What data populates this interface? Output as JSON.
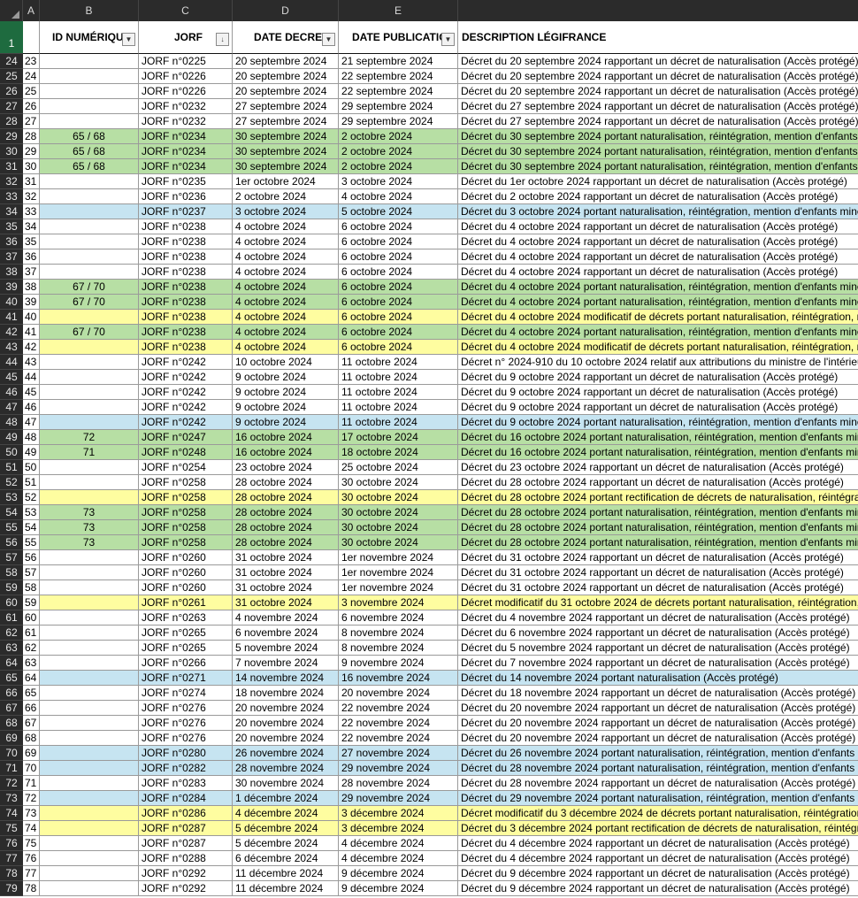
{
  "columns": {
    "a": "A",
    "b": "B",
    "c": "C",
    "d": "D",
    "e": "E"
  },
  "header_row_number": "1",
  "headers": {
    "b": "ID NUMÉRIQUE",
    "c": "JORF",
    "d": "DATE DECRET",
    "e": "DATE PUBLICATION",
    "f": "DESCRIPTION LÉGIFRANCE"
  },
  "icons": {
    "filter": "filter-dropdown-icon",
    "sorted_filter": "sort-ascending-filter-icon",
    "select_all": "select-all-triangle-icon"
  },
  "colors": {
    "green": "#b7dfa4",
    "yellow": "#fefda0",
    "blue": "#c6e4f1",
    "selected_row_header": "#1e6b3f"
  },
  "rows": [
    {
      "r": "24",
      "a": "23",
      "b": "",
      "c": "JORF n°0225",
      "d": "20 septembre 2024",
      "e": "21 septembre 2024",
      "f": "Décret du 20 septembre 2024 rapportant un décret de naturalisation (Accès protégé)",
      "bg": ""
    },
    {
      "r": "25",
      "a": "24",
      "b": "",
      "c": "JORF n°0226",
      "d": "20 septembre 2024",
      "e": "22 septembre 2024",
      "f": "Décret du 20 septembre 2024 rapportant un décret de naturalisation (Accès protégé)",
      "bg": ""
    },
    {
      "r": "26",
      "a": "25",
      "b": "",
      "c": "JORF n°0226",
      "d": "20 septembre 2024",
      "e": "22 septembre 2024",
      "f": "Décret du 20 septembre 2024 rapportant un décret de naturalisation (Accès protégé)",
      "bg": ""
    },
    {
      "r": "27",
      "a": "26",
      "b": "",
      "c": "JORF n°0232",
      "d": "27 septembre 2024",
      "e": "29 septembre 2024",
      "f": "Décret du 27 septembre 2024 rapportant un décret de naturalisation (Accès protégé)",
      "bg": ""
    },
    {
      "r": "28",
      "a": "27",
      "b": "",
      "c": "JORF n°0232",
      "d": "27 septembre 2024",
      "e": "29 septembre 2024",
      "f": "Décret du 27 septembre 2024 rapportant un décret de naturalisation (Accès protégé)",
      "bg": ""
    },
    {
      "r": "29",
      "a": "28",
      "b": "65 / 68",
      "c": "JORF n°0234",
      "d": "30 septembre 2024",
      "e": "2 octobre 2024",
      "f": "Décret du 30 septembre 2024 portant naturalisation, réintégration, mention d'enfants m",
      "bg": "green"
    },
    {
      "r": "30",
      "a": "29",
      "b": "65 / 68",
      "c": "JORF n°0234",
      "d": "30 septembre 2024",
      "e": "2 octobre 2024",
      "f": "Décret du 30 septembre 2024 portant naturalisation, réintégration, mention d'enfants m",
      "bg": "green"
    },
    {
      "r": "31",
      "a": "30",
      "b": "65 / 68",
      "c": "JORF n°0234",
      "d": "30 septembre 2024",
      "e": "2 octobre 2024",
      "f": "Décret du 30 septembre 2024 portant naturalisation, réintégration, mention d'enfants m",
      "bg": "green"
    },
    {
      "r": "32",
      "a": "31",
      "b": "",
      "c": "JORF n°0235",
      "d": "1er octobre 2024",
      "e": "3 octobre 2024",
      "f": "Décret du 1er octobre 2024 rapportant un décret de naturalisation (Accès protégé)",
      "bg": ""
    },
    {
      "r": "33",
      "a": "32",
      "b": "",
      "c": "JORF n°0236",
      "d": "2 octobre 2024",
      "e": "4 octobre 2024",
      "f": "Décret du 2 octobre 2024 rapportant un décret de naturalisation (Accès protégé)",
      "bg": ""
    },
    {
      "r": "34",
      "a": "33",
      "b": "",
      "c": "JORF n°0237",
      "d": "3 octobre 2024",
      "e": "5 octobre 2024",
      "f": "Décret du 3 octobre 2024 portant naturalisation, réintégration, mention d'enfants mine",
      "bg": "blue"
    },
    {
      "r": "35",
      "a": "34",
      "b": "",
      "c": "JORF n°0238",
      "d": "4 octobre 2024",
      "e": "6 octobre 2024",
      "f": "Décret du 4 octobre 2024 rapportant un décret de naturalisation (Accès protégé)",
      "bg": ""
    },
    {
      "r": "36",
      "a": "35",
      "b": "",
      "c": "JORF n°0238",
      "d": "4 octobre 2024",
      "e": "6 octobre 2024",
      "f": "Décret du 4 octobre 2024 rapportant un décret de naturalisation (Accès protégé)",
      "bg": ""
    },
    {
      "r": "37",
      "a": "36",
      "b": "",
      "c": "JORF n°0238",
      "d": "4 octobre 2024",
      "e": "6 octobre 2024",
      "f": "Décret du 4 octobre 2024 rapportant un décret de naturalisation (Accès protégé)",
      "bg": ""
    },
    {
      "r": "38",
      "a": "37",
      "b": "",
      "c": "JORF n°0238",
      "d": "4 octobre 2024",
      "e": "6 octobre 2024",
      "f": "Décret du 4 octobre 2024 rapportant un décret de naturalisation (Accès protégé)",
      "bg": ""
    },
    {
      "r": "39",
      "a": "38",
      "b": "67 / 70",
      "c": "JORF n°0238",
      "d": "4 octobre 2024",
      "e": "6 octobre 2024",
      "f": "Décret du 4 octobre 2024 portant naturalisation, réintégration, mention d'enfants mine",
      "bg": "green"
    },
    {
      "r": "40",
      "a": "39",
      "b": "67 / 70",
      "c": "JORF n°0238",
      "d": "4 octobre 2024",
      "e": "6 octobre 2024",
      "f": "Décret du 4 octobre 2024 portant naturalisation, réintégration, mention d'enfants mine",
      "bg": "green"
    },
    {
      "r": "41",
      "a": "40",
      "b": "",
      "c": "JORF n°0238",
      "d": "4 octobre 2024",
      "e": "6 octobre 2024",
      "f": "Décret du 4 octobre 2024 modificatif de décrets portant naturalisation, réintégration, m",
      "bg": "yellow"
    },
    {
      "r": "42",
      "a": "41",
      "b": "67 / 70",
      "c": "JORF n°0238",
      "d": "4 octobre 2024",
      "e": "6 octobre 2024",
      "f": "Décret du 4 octobre 2024 portant naturalisation, réintégration, mention d'enfants mine",
      "bg": "green"
    },
    {
      "r": "43",
      "a": "42",
      "b": "",
      "c": "JORF n°0238",
      "d": "4 octobre 2024",
      "e": "6 octobre 2024",
      "f": "Décret du 4 octobre 2024 modificatif de décrets portant naturalisation, réintégration, m",
      "bg": "yellow"
    },
    {
      "r": "44",
      "a": "43",
      "b": "",
      "c": "JORF n°0242",
      "d": "10 octobre 2024",
      "e": "11 octobre 2024",
      "f": "Décret n° 2024-910 du 10 octobre 2024 relatif aux attributions du ministre de l'intérieu",
      "bg": ""
    },
    {
      "r": "45",
      "a": "44",
      "b": "",
      "c": "JORF n°0242",
      "d": "9 octobre 2024",
      "e": "11 octobre 2024",
      "f": "Décret du 9 octobre 2024 rapportant un décret de naturalisation (Accès protégé)",
      "bg": ""
    },
    {
      "r": "46",
      "a": "45",
      "b": "",
      "c": "JORF n°0242",
      "d": "9 octobre 2024",
      "e": "11 octobre 2024",
      "f": "Décret du 9 octobre 2024 rapportant un décret de naturalisation (Accès protégé)",
      "bg": ""
    },
    {
      "r": "47",
      "a": "46",
      "b": "",
      "c": "JORF n°0242",
      "d": "9 octobre 2024",
      "e": "11 octobre 2024",
      "f": "Décret du 9 octobre 2024 rapportant un décret de naturalisation (Accès protégé)",
      "bg": ""
    },
    {
      "r": "48",
      "a": "47",
      "b": "",
      "c": "JORF n°0242",
      "d": "9 octobre 2024",
      "e": "11 octobre 2024",
      "f": "Décret du 9 octobre 2024 portant naturalisation, réintégration, mention d'enfants mine",
      "bg": "blue"
    },
    {
      "r": "49",
      "a": "48",
      "b": "72",
      "c": "JORF n°0247",
      "d": "16 octobre 2024",
      "e": "17 octobre 2024",
      "f": "Décret du 16 octobre 2024 portant naturalisation, réintégration, mention d'enfants min",
      "bg": "green"
    },
    {
      "r": "50",
      "a": "49",
      "b": "71",
      "c": "JORF n°0248",
      "d": "16 octobre 2024",
      "e": "18 octobre 2024",
      "f": "Décret du 16 octobre 2024 portant naturalisation, réintégration, mention d'enfants min",
      "bg": "green"
    },
    {
      "r": "51",
      "a": "50",
      "b": "",
      "c": "JORF n°0254",
      "d": "23 octobre 2024",
      "e": "25 octobre 2024",
      "f": "Décret du 23 octobre 2024 rapportant un décret de naturalisation (Accès protégé)",
      "bg": ""
    },
    {
      "r": "52",
      "a": "51",
      "b": "",
      "c": "JORF n°0258",
      "d": "28 octobre 2024",
      "e": "30 octobre 2024",
      "f": "Décret du 28 octobre 2024 rapportant un décret de naturalisation (Accès protégé)",
      "bg": ""
    },
    {
      "r": "53",
      "a": "52",
      "b": "",
      "c": "JORF n°0258",
      "d": "28 octobre 2024",
      "e": "30 octobre 2024",
      "f": "Décret du 28 octobre 2024 portant rectification de décrets de naturalisation, réintégrat",
      "bg": "yellow"
    },
    {
      "r": "54",
      "a": "53",
      "b": "73",
      "c": "JORF n°0258",
      "d": "28 octobre 2024",
      "e": "30 octobre 2024",
      "f": "Décret du 28 octobre 2024 portant naturalisation, réintégration, mention d'enfants min",
      "bg": "green"
    },
    {
      "r": "55",
      "a": "54",
      "b": "73",
      "c": "JORF n°0258",
      "d": "28 octobre 2024",
      "e": "30 octobre 2024",
      "f": "Décret du 28 octobre 2024 portant naturalisation, réintégration, mention d'enfants min",
      "bg": "green"
    },
    {
      "r": "56",
      "a": "55",
      "b": "73",
      "c": "JORF n°0258",
      "d": "28 octobre 2024",
      "e": "30 octobre 2024",
      "f": "Décret du 28 octobre 2024 portant naturalisation, réintégration, mention d'enfants min",
      "bg": "green"
    },
    {
      "r": "57",
      "a": "56",
      "b": "",
      "c": "JORF n°0260",
      "d": "31 octobre 2024",
      "e": "1er novembre 2024",
      "f": "Décret du 31 octobre 2024 rapportant un décret de naturalisation (Accès protégé)",
      "bg": ""
    },
    {
      "r": "58",
      "a": "57",
      "b": "",
      "c": "JORF n°0260",
      "d": "31 octobre 2024",
      "e": "1er novembre 2024",
      "f": "Décret du 31 octobre 2024 rapportant un décret de naturalisation (Accès protégé)",
      "bg": ""
    },
    {
      "r": "59",
      "a": "58",
      "b": "",
      "c": "JORF n°0260",
      "d": "31 octobre 2024",
      "e": "1er novembre 2024",
      "f": "Décret du 31 octobre 2024 rapportant un décret de naturalisation (Accès protégé)",
      "bg": ""
    },
    {
      "r": "60",
      "a": "59",
      "b": "",
      "c": "JORF n°0261",
      "d": "31 octobre 2024",
      "e": "3 novembre 2024",
      "f": "Décret modificatif du 31 octobre 2024 de décrets portant naturalisation, réintégration, r",
      "bg": "yellow"
    },
    {
      "r": "61",
      "a": "60",
      "b": "",
      "c": "JORF n°0263",
      "d": "4 novembre 2024",
      "e": "6 novembre 2024",
      "f": "Décret du 4 novembre 2024 rapportant un décret de naturalisation (Accès protégé)",
      "bg": ""
    },
    {
      "r": "62",
      "a": "61",
      "b": "",
      "c": "JORF n°0265",
      "d": "6 novembre 2024",
      "e": "8 novembre 2024",
      "f": "Décret du 6 novembre 2024 rapportant un décret de naturalisation (Accès protégé)",
      "bg": ""
    },
    {
      "r": "63",
      "a": "62",
      "b": "",
      "c": "JORF n°0265",
      "d": "5 novembre 2024",
      "e": "8 novembre 2024",
      "f": "Décret du 5 novembre 2024 rapportant un décret de naturalisation (Accès protégé)",
      "bg": ""
    },
    {
      "r": "64",
      "a": "63",
      "b": "",
      "c": "JORF n°0266",
      "d": "7 novembre 2024",
      "e": "9 novembre 2024",
      "f": "Décret du 7 novembre 2024 rapportant un décret de naturalisation (Accès protégé)",
      "bg": ""
    },
    {
      "r": "65",
      "a": "64",
      "b": "",
      "c": "JORF n°0271",
      "d": "14 novembre 2024",
      "e": "16 novembre 2024",
      "f": "Décret du 14 novembre 2024 portant naturalisation (Accès protégé)",
      "bg": "blue"
    },
    {
      "r": "66",
      "a": "65",
      "b": "",
      "c": "JORF n°0274",
      "d": "18 novembre 2024",
      "e": "20 novembre 2024",
      "f": "Décret du 18 novembre 2024 rapportant un décret de naturalisation (Accès protégé)",
      "bg": ""
    },
    {
      "r": "67",
      "a": "66",
      "b": "",
      "c": "JORF n°0276",
      "d": "20 novembre 2024",
      "e": "22 novembre 2024",
      "f": "Décret du 20 novembre 2024 rapportant un décret de naturalisation (Accès protégé)",
      "bg": ""
    },
    {
      "r": "68",
      "a": "67",
      "b": "",
      "c": "JORF n°0276",
      "d": "20 novembre 2024",
      "e": "22 novembre 2024",
      "f": "Décret du 20 novembre 2024 rapportant un décret de naturalisation (Accès protégé)",
      "bg": ""
    },
    {
      "r": "69",
      "a": "68",
      "b": "",
      "c": "JORF n°0276",
      "d": "20 novembre 2024",
      "e": "22 novembre 2024",
      "f": "Décret du 20 novembre 2024 rapportant un décret de naturalisation (Accès protégé)",
      "bg": ""
    },
    {
      "r": "70",
      "a": "69",
      "b": "",
      "c": "JORF n°0280",
      "d": "26 novembre 2024",
      "e": "27 novembre 2024",
      "f": "Décret du 26 novembre 2024 portant naturalisation, réintégration, mention d'enfants m",
      "bg": "blue"
    },
    {
      "r": "71",
      "a": "70",
      "b": "",
      "c": "JORF n°0282",
      "d": "28 novembre 2024",
      "e": "29 novembre 2024",
      "f": "Décret du 28 novembre 2024 portant naturalisation, réintégration, mention d'enfants m",
      "bg": "blue"
    },
    {
      "r": "72",
      "a": "71",
      "b": "",
      "c": "JORF n°0283",
      "d": "30 novembre 2024",
      "e": "28 novembre 2024",
      "f": "Décret du 28 novembre 2024 rapportant un décret de naturalisation (Accès protégé)",
      "bg": ""
    },
    {
      "r": "73",
      "a": "72",
      "b": "",
      "c": "JORF n°0284",
      "d": "1 décembre 2024",
      "e": "29 novembre 2024",
      "f": "Décret du 29 novembre 2024 portant naturalisation, réintégration, mention d'enfants m",
      "bg": "blue"
    },
    {
      "r": "74",
      "a": "73",
      "b": "",
      "c": "JORF n°0286",
      "d": "4 décembre 2024",
      "e": "3 décembre 2024",
      "f": "Décret modificatif du 3 décembre 2024 de décrets portant naturalisation, réintégration,",
      "bg": "yellow"
    },
    {
      "r": "75",
      "a": "74",
      "b": "",
      "c": "JORF n°0287",
      "d": "5 décembre 2024",
      "e": "3 décembre 2024",
      "f": "Décret du 3 décembre 2024 portant rectification de décrets de naturalisation, réintégrat",
      "bg": "yellow"
    },
    {
      "r": "76",
      "a": "75",
      "b": "",
      "c": "JORF n°0287",
      "d": "5 décembre 2024",
      "e": "4 décembre 2024",
      "f": "Décret du 4 décembre 2024 rapportant un décret de naturalisation (Accès protégé)",
      "bg": ""
    },
    {
      "r": "77",
      "a": "76",
      "b": "",
      "c": "JORF n°0288",
      "d": "6 décembre 2024",
      "e": "4 décembre 2024",
      "f": "Décret du 4 décembre 2024 rapportant un décret de naturalisation (Accès protégé)",
      "bg": ""
    },
    {
      "r": "78",
      "a": "77",
      "b": "",
      "c": "JORF n°0292",
      "d": "11 décembre 2024",
      "e": "9 décembre 2024",
      "f": "Décret du 9 décembre 2024 rapportant un décret de naturalisation (Accès protégé)",
      "bg": ""
    },
    {
      "r": "79",
      "a": "78",
      "b": "",
      "c": "JORF n°0292",
      "d": "11 décembre 2024",
      "e": "9 décembre 2024",
      "f": "Décret du 9 décembre 2024 rapportant un décret de naturalisation (Accès protégé)",
      "bg": ""
    }
  ]
}
